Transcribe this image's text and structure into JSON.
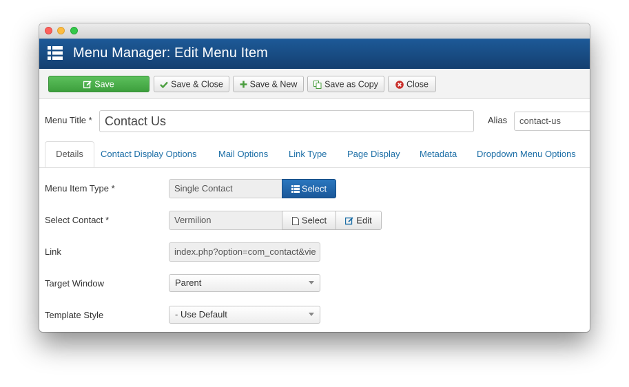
{
  "header": {
    "title": "Menu Manager: Edit Menu Item",
    "icon": "list-icon"
  },
  "toolbar": {
    "save": "Save",
    "save_close": "Save & Close",
    "save_new": "Save & New",
    "save_copy": "Save as Copy",
    "close": "Close"
  },
  "menu_title": {
    "label": "Menu Title *",
    "value": "Contact Us"
  },
  "alias": {
    "label": "Alias",
    "value": "contact-us"
  },
  "tabs": [
    {
      "label": "Details",
      "active": true
    },
    {
      "label": "Contact Display Options"
    },
    {
      "label": "Mail Options"
    },
    {
      "label": "Link Type"
    },
    {
      "label": "Page Display"
    },
    {
      "label": "Metadata"
    },
    {
      "label": "Dropdown Menu Options"
    }
  ],
  "fields": {
    "menu_item_type": {
      "label": "Menu Item Type *",
      "value": "Single Contact",
      "button": "Select"
    },
    "select_contact": {
      "label": "Select Contact *",
      "value": "Vermilion",
      "select_button": "Select",
      "edit_button": "Edit"
    },
    "link": {
      "label": "Link",
      "value": "index.php?option=com_contact&vie"
    },
    "target_window": {
      "label": "Target Window",
      "value": "Parent"
    },
    "template_style": {
      "label": "Template Style",
      "value": "- Use Default"
    }
  },
  "colors": {
    "header": "#1a4f89",
    "save_green": "#4cae4c",
    "link_blue": "#1c6ea6",
    "select_blue": "#1f63a8"
  }
}
